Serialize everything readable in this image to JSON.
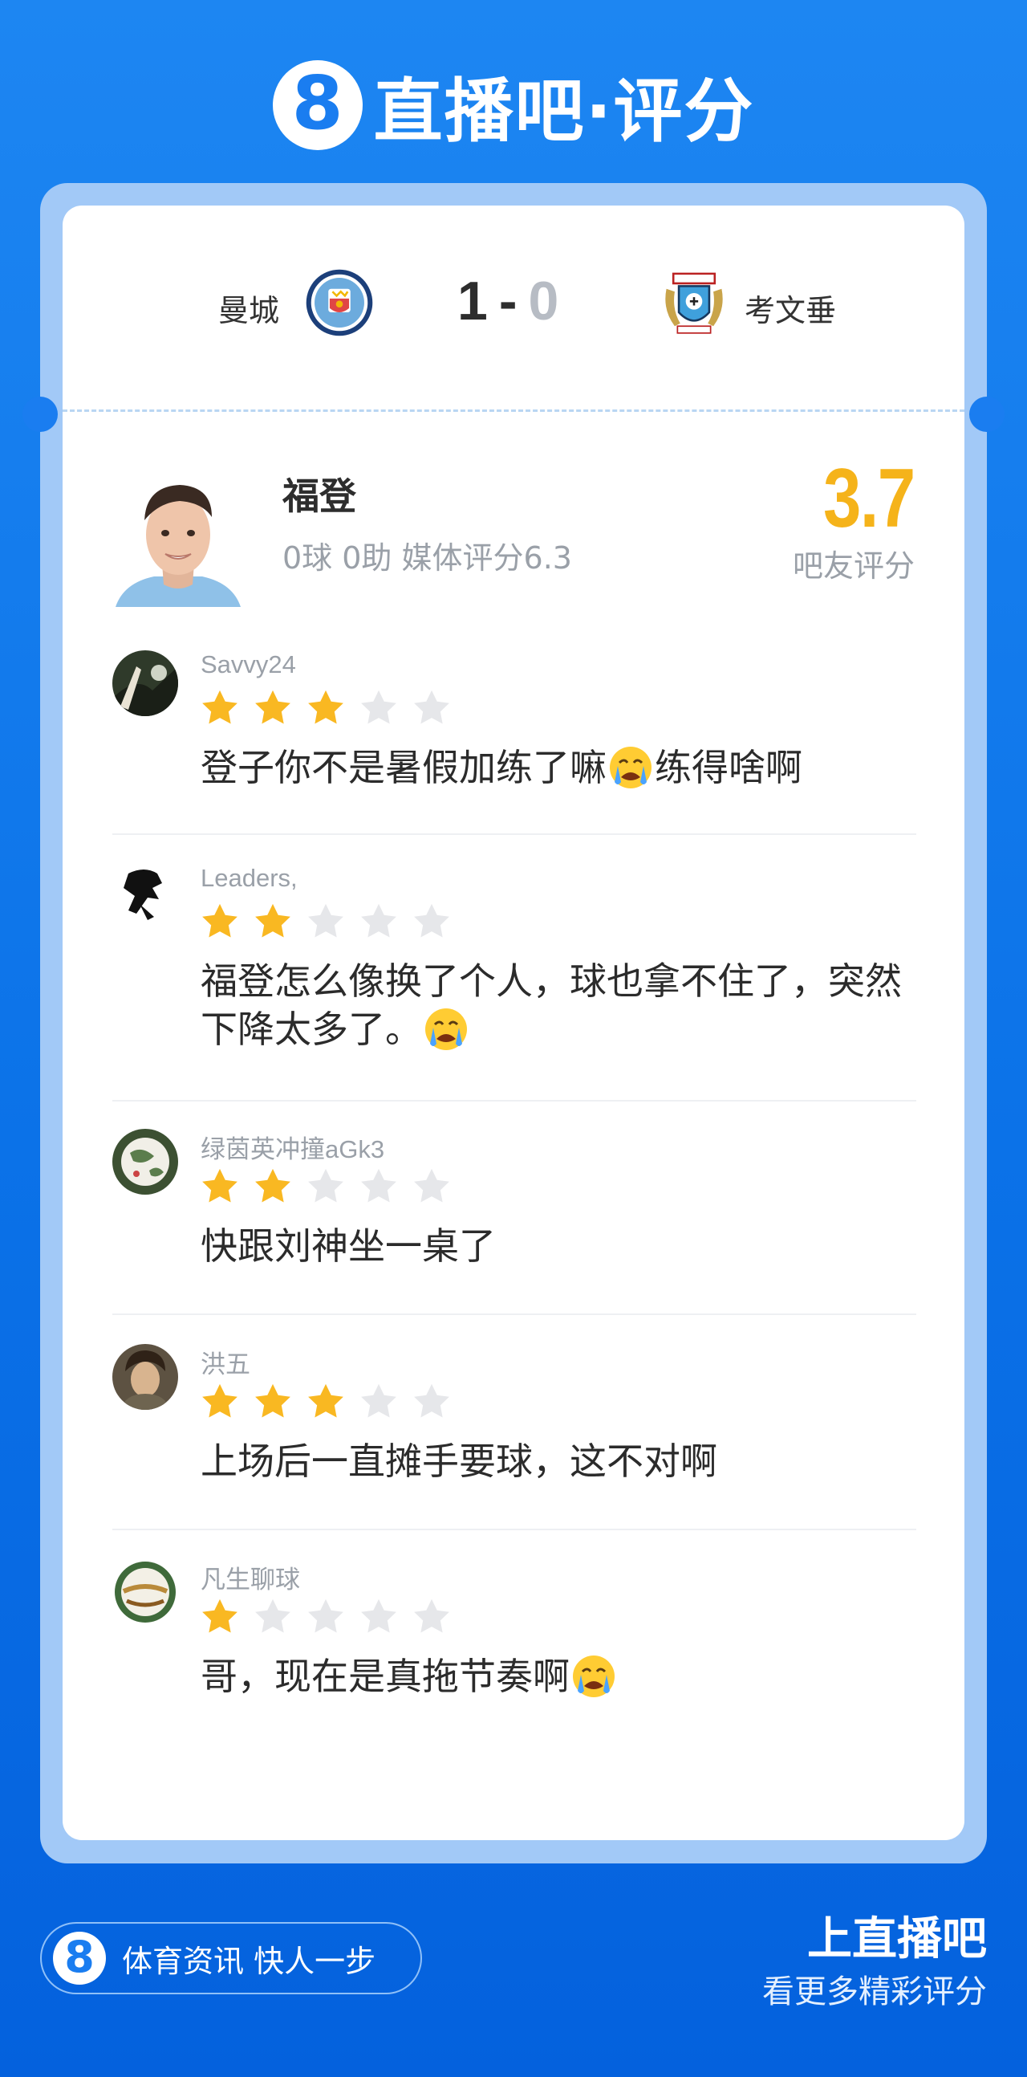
{
  "brand": {
    "logo_glyph": "8",
    "title": "直播吧·评分"
  },
  "match": {
    "home_team": "曼城",
    "home_score": "1",
    "separator": "-",
    "away_score": "0",
    "away_team": "考文垂",
    "home_crest_icon": "manchester-city-crest-icon",
    "away_crest_icon": "coventry-city-crest-icon"
  },
  "player": {
    "name": "福登",
    "stats": "0球 0助 媒体评分6.3",
    "fan_score": "3.7",
    "fan_score_label": "吧友评分"
  },
  "comments": [
    {
      "user": "Savvy24",
      "stars": 3,
      "text_before": "登子你不是暑假加练了嘛",
      "emoji": "crying-face",
      "text_after": "练得啥啊"
    },
    {
      "user": "Leaders,",
      "stars": 2,
      "text_before": "福登怎么像换了个人，球也拿不住了，突然下降太多了。",
      "emoji": "crying-face",
      "text_after": ""
    },
    {
      "user": "绿茵英冲撞aGk3",
      "stars": 2,
      "text_before": "快跟刘神坐一桌了",
      "emoji": "",
      "text_after": ""
    },
    {
      "user": "洪五",
      "stars": 3,
      "text_before": "上场后一直摊手要球，这不对啊",
      "emoji": "",
      "text_after": ""
    },
    {
      "user": "凡生聊球",
      "stars": 1,
      "text_before": "哥，现在是真拖节奏啊",
      "emoji": "crying-face",
      "text_after": ""
    }
  ],
  "footer": {
    "slogan_glyph": "8",
    "slogan": "体育资讯 快人一步",
    "cta_title": "上直播吧",
    "cta_subtitle": "看更多精彩评分"
  },
  "colors": {
    "background": "#0b72e8",
    "frame": "#a2c9f7",
    "star_on": "#f9b822",
    "star_off": "#e6e7ea",
    "fan_score": "#f5b31a"
  }
}
